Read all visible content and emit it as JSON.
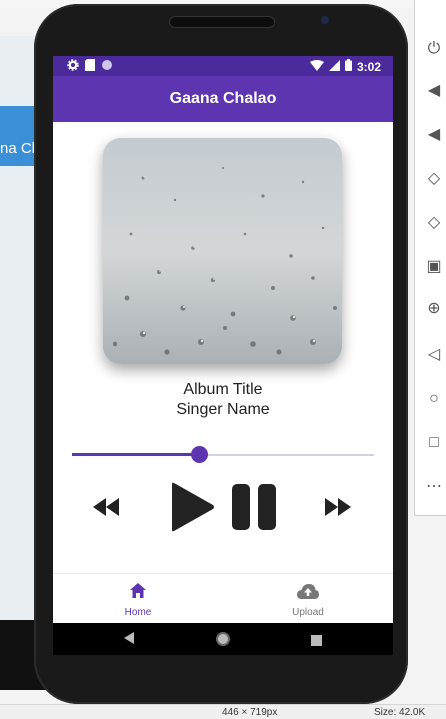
{
  "app": {
    "title": "Gaana Chalao",
    "time": "3:02"
  },
  "track": {
    "album_title": "Album Title",
    "singer_name": "Singer Name",
    "progress": 0.42
  },
  "bottom_nav": {
    "items": [
      {
        "label": "Home",
        "icon": "home-icon",
        "active": true
      },
      {
        "label": "Upload",
        "icon": "cloud-upload-icon",
        "active": false
      }
    ]
  },
  "host": {
    "background_app_text": "na Ch",
    "status_dimensions": "446 × 719px",
    "status_size": "Size: 42.0K"
  },
  "colors": {
    "statusbar": "#4b2a9b",
    "appbar": "#5e35b1",
    "accent": "#5e35b1"
  }
}
